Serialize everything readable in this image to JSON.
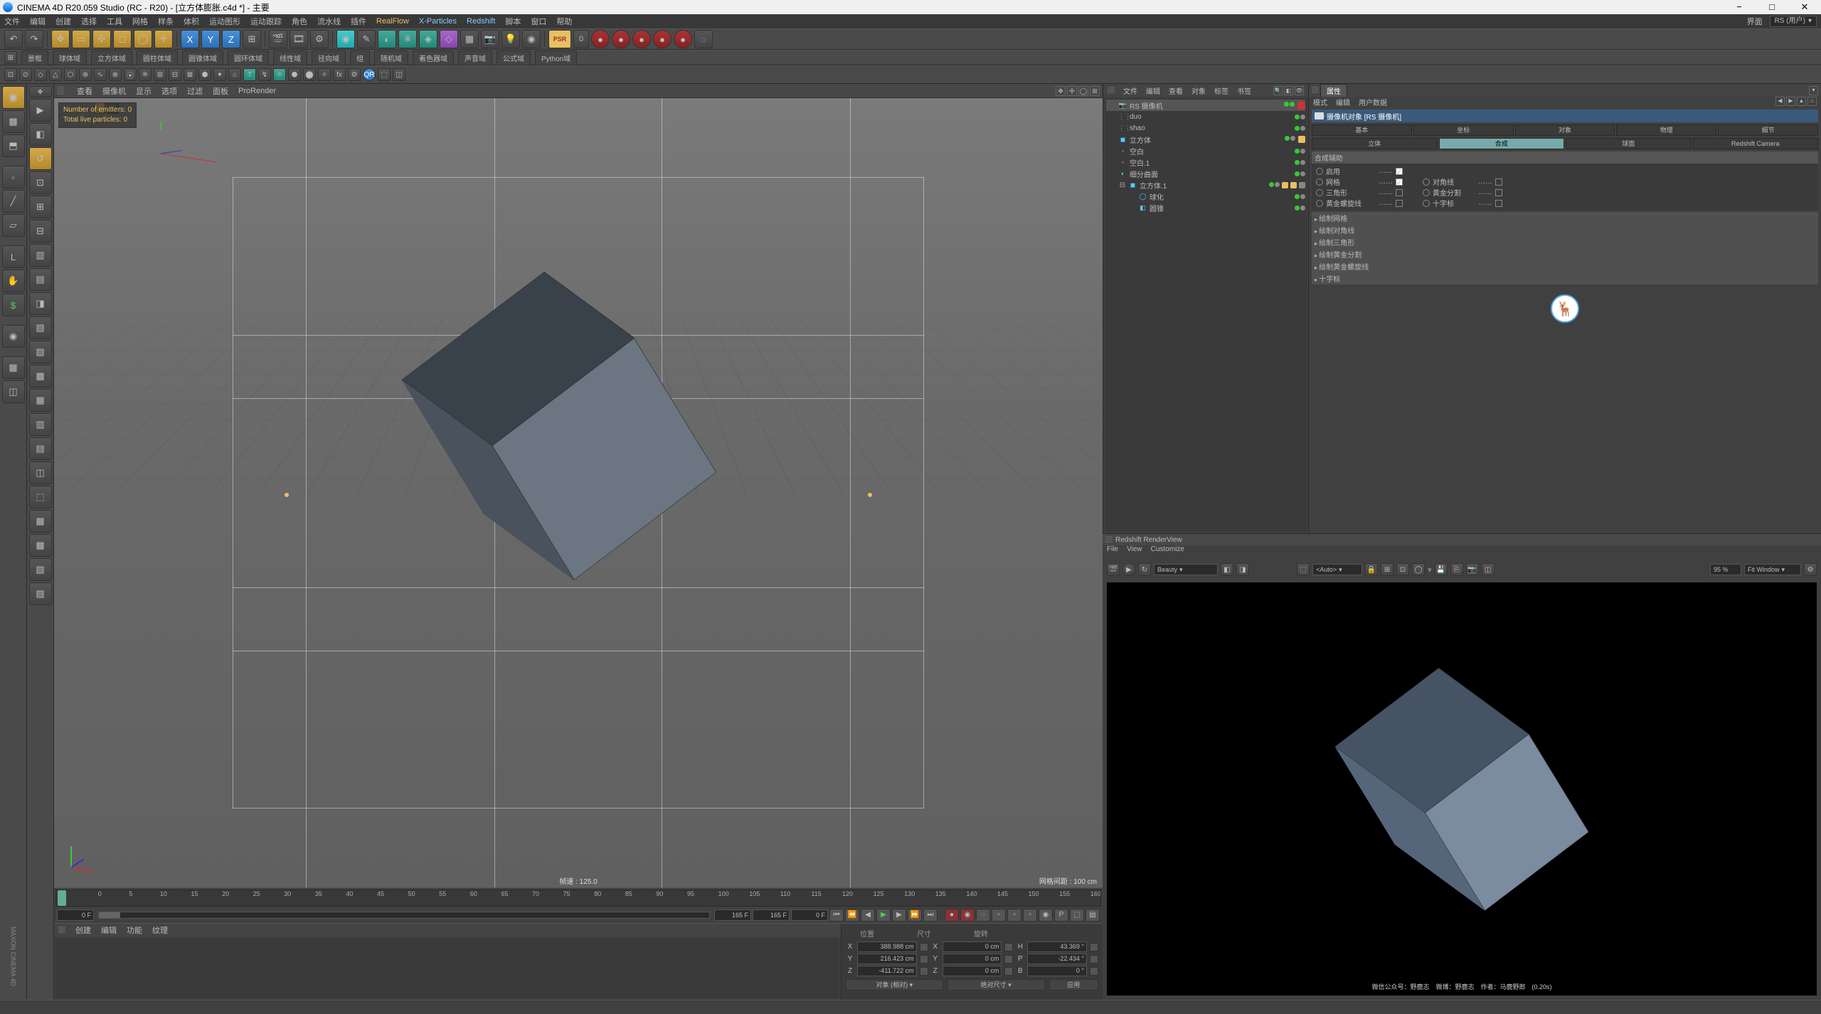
{
  "title": "CINEMA 4D R20.059 Studio (RC - R20) - [立方体膨胀.c4d *] - 主要",
  "mainmenu": [
    "文件",
    "编辑",
    "创建",
    "选择",
    "工具",
    "网格",
    "样条",
    "体积",
    "运动图形",
    "运动跟踪",
    "角色",
    "流水线",
    "插件",
    "RealFlow",
    "X-Particles",
    "Redshift",
    "脚本",
    "窗口",
    "帮助"
  ],
  "layout_label": "界面",
  "layout_value": "RS (用户)",
  "row2": {
    "items": [
      "景框",
      "球体域",
      "立方体域",
      "圆柱体域",
      "圆锥体域",
      "圆环体域",
      "线性域",
      "径向域",
      "组",
      "随机域",
      "着色器域",
      "声音域",
      "公式域",
      "Python域"
    ],
    "psr": "PSR",
    "zero": "0"
  },
  "vp": {
    "menu": [
      "查看",
      "摄像机",
      "显示",
      "选项",
      "过滤",
      "面板",
      "ProRender"
    ],
    "stats_emitters": "Number of emitters: 0",
    "stats_particles": "Total live particles: 0",
    "state_label": "帧速",
    "state_value": "125.0",
    "grid_label": "网格间距",
    "grid_value": "100 cm"
  },
  "timeline": {
    "start": "0 F",
    "frames": "165 F",
    "end": "165 F",
    "endB": "0 F",
    "rstart": 0,
    "rend": 165
  },
  "mat": {
    "menu": [
      "创建",
      "编辑",
      "功能",
      "纹理"
    ]
  },
  "coords": {
    "hdr": [
      "位置",
      "尺寸",
      "旋转"
    ],
    "x": {
      "p": "388.988 cm",
      "s": "0 cm",
      "r": "43.369 °"
    },
    "y": {
      "p": "216.423 cm",
      "s": "0 cm",
      "r": "-22.434 °"
    },
    "z": {
      "p": "-411.722 cm",
      "s": "0 cm",
      "r": "0 °"
    },
    "dd1": "对象 (相对)",
    "dd2": "绝对尺寸",
    "apply": "应用"
  },
  "obj": {
    "menu": [
      "文件",
      "编辑",
      "查看",
      "对象",
      "标签",
      "书签"
    ],
    "tree": [
      {
        "lvl": 0,
        "ico": "cam",
        "col": "#8cf",
        "name": "RS 摄像机",
        "sel": true,
        "vis": [
          "g",
          "g"
        ],
        "tag": "rs"
      },
      {
        "lvl": 0,
        "ico": "dots",
        "col": "#5c5",
        "name": "duo",
        "vis": [
          "g",
          "gr"
        ]
      },
      {
        "lvl": 0,
        "ico": "dots",
        "col": "#5c5",
        "name": "shao",
        "vis": [
          "g",
          "gr"
        ]
      },
      {
        "lvl": 0,
        "ico": "cube",
        "col": "#5cf",
        "name": "立方体",
        "vis": [
          "g",
          "gr"
        ],
        "extra": true
      },
      {
        "lvl": 0,
        "ico": "null",
        "col": "#ccc",
        "name": "空白",
        "vis": [
          "g",
          "gr"
        ]
      },
      {
        "lvl": 0,
        "ico": "null",
        "col": "#ccc",
        "name": "空白.1",
        "vis": [
          "g",
          "gr"
        ]
      },
      {
        "lvl": 0,
        "ico": "surf",
        "col": "#5cf",
        "name": "细分曲面",
        "vis": [
          "g",
          "gr"
        ]
      },
      {
        "lvl": 1,
        "ico": "cube",
        "col": "#5cf",
        "name": "立方体.1",
        "sw": "⊟",
        "vis": [
          "g",
          "gr"
        ],
        "disc": true
      },
      {
        "lvl": 2,
        "ico": "sph",
        "col": "#5cf",
        "name": "球化",
        "vis": [
          "g",
          "gr"
        ]
      },
      {
        "lvl": 2,
        "ico": "wrap",
        "col": "#5cf",
        "name": "圆锥",
        "vis": [
          "g",
          "gr"
        ]
      }
    ]
  },
  "attr": {
    "tab": "属性",
    "menu": [
      "模式",
      "编辑",
      "用户数据"
    ],
    "obj": "摄像机对象 [RS 摄像机]",
    "tabs1": [
      "基本",
      "坐标",
      "对象",
      "物理",
      "细节"
    ],
    "tabs2": [
      "立体",
      "合成",
      "球面",
      "Redshift Camera"
    ],
    "active_tab": "合成",
    "sectitle": "合成辅助",
    "props": [
      {
        "l": "启用",
        "chk": true
      },
      {
        "l": "网格",
        "chk": true,
        "l2": "对角线",
        "chk2": false
      },
      {
        "l": "三角形",
        "chk": false,
        "l2": "黄金分割",
        "chk2": false
      },
      {
        "l": "黄金螺旋线",
        "chk": false,
        "l2": "十字标",
        "chk2": false
      }
    ],
    "accords": [
      "绘制网格",
      "绘制对角线",
      "绘制三角形",
      "绘制黄金分割",
      "绘制黄金螺旋线",
      "十字标"
    ]
  },
  "rs": {
    "title": "Redshift RenderView",
    "menu": [
      "File",
      "View",
      "Customize"
    ],
    "aov": "Beauty",
    "auto": "<Auto>",
    "pct": "95 %",
    "fit": "Fit Window",
    "caption": "微信公众号：野鹿志　微博：野鹿志　作者：马鹿野郎　(0.20s)"
  }
}
